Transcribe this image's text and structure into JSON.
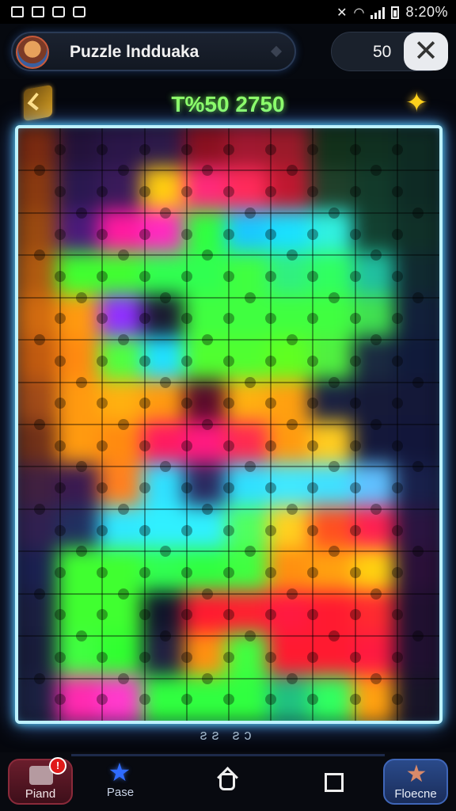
{
  "status_bar": {
    "time": "8:20%",
    "icons": [
      "gallery-icon",
      "image-icon",
      "shield-icon",
      "bag-icon"
    ],
    "right_icons": [
      "mute-icon",
      "wifi-icon",
      "signal-icon",
      "battery-icon"
    ]
  },
  "header": {
    "title": "Puzzle lndduaka",
    "score": "50",
    "close_label": "✕"
  },
  "hud": {
    "score_line": "T%50 2750",
    "back_icon": "back-arrow-icon",
    "star_icon": "sparkle-icon"
  },
  "board": {
    "cols": 10,
    "rows": 14,
    "tile_colors": [
      [
        "#7a2a10",
        "#23123a",
        "#2a1648",
        "#2d1a4a",
        "#8a1020",
        "#a01830",
        "#9a1a2a",
        "#12301a",
        "#103020",
        "#0e2a22"
      ],
      [
        "#8a3a10",
        "#2a1850",
        "#3a1a5a",
        "#ffcc10",
        "#ff2a7a",
        "#ff2a5a",
        "#c01830",
        "#20402a",
        "#123a2a",
        "#0e2a24"
      ],
      [
        "#9a4a10",
        "#4a1a7a",
        "#ff1aa0",
        "#ff2ac0",
        "#30ff40",
        "#1ac8ff",
        "#1ae0ff",
        "#30f0e0",
        "#124030",
        "#103028"
      ],
      [
        "#b05a10",
        "#40ff30",
        "#40ff30",
        "#30ff50",
        "#30ff50",
        "#40ff40",
        "#30f080",
        "#30ff60",
        "#20c0a0",
        "#102a30"
      ],
      [
        "#d06a10",
        "#ff9a10",
        "#9030ff",
        "#1a1a30",
        "#40ff40",
        "#40ff40",
        "#40ff40",
        "#40ff40",
        "#40e050",
        "#12203a"
      ],
      [
        "#c05a10",
        "#ff8a10",
        "#50ff40",
        "#20e0ff",
        "#50ff30",
        "#50ff30",
        "#60ff20",
        "#50f040",
        "#1a2a40",
        "#101a3a"
      ],
      [
        "#a04a18",
        "#ff9a10",
        "#ffb010",
        "#ff9a10",
        "#5a0a2a",
        "#ffb010",
        "#ffa010",
        "#1a2040",
        "#161a38",
        "#141838"
      ],
      [
        "#703018",
        "#ff9a10",
        "#ff8a10",
        "#ff1a60",
        "#ff1a80",
        "#ff2a50",
        "#ff9a10",
        "#ffcc20",
        "#14183a",
        "#12163a"
      ],
      [
        "#402040",
        "#3a1a50",
        "#ff8020",
        "#30e0ff",
        "#2a2a60",
        "#30e0ff",
        "#40e8ff",
        "#40e0ff",
        "#60c0ff",
        "#18204a"
      ],
      [
        "#302050",
        "#203060",
        "#30e8ff",
        "#30f0ff",
        "#30f0ff",
        "#50ff60",
        "#ffd020",
        "#ff5020",
        "#ff2050",
        "#2a1440"
      ],
      [
        "#1a2050",
        "#40ff30",
        "#40ff30",
        "#30ff50",
        "#30ff40",
        "#40ff40",
        "#ff9010",
        "#ffa010",
        "#ffd010",
        "#2a1038"
      ],
      [
        "#1a1e40",
        "#40ff30",
        "#40ff30",
        "#10142a",
        "#ff1a30",
        "#ff2030",
        "#ff1a40",
        "#ff1a30",
        "#ff2a30",
        "#201030"
      ],
      [
        "#181c3a",
        "#40ff40",
        "#30ff30",
        "#202040",
        "#ff9010",
        "#40ff40",
        "#ff1a30",
        "#ff1a30",
        "#ff1a40",
        "#201030"
      ],
      [
        "#1a2040",
        "#ff2ab0",
        "#ff3acc",
        "#30ff40",
        "#30ff40",
        "#30ff40",
        "#20c080",
        "#30ff60",
        "#ffa010",
        "#181428"
      ]
    ]
  },
  "pager": {
    "text": "ƨƨ ƨɔ"
  },
  "bottom_nav": {
    "find_label": "Piand",
    "find_badge": "!",
    "pause_label": "Pase",
    "resume_label": "Floecne"
  }
}
